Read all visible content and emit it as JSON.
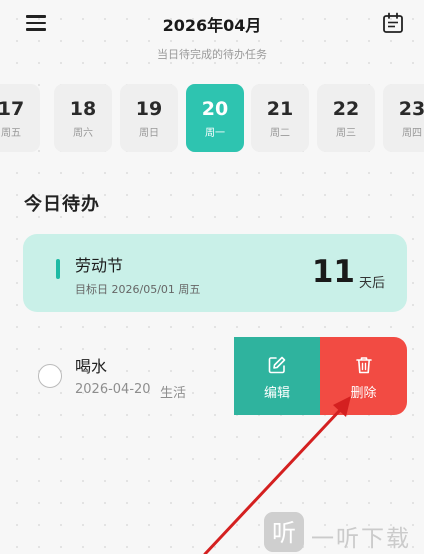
{
  "header": {
    "menu_icon": "hamburger-menu-icon",
    "title": "2026年04月",
    "subtitle": "当日待完成的待办任务",
    "calendar_icon": "calendar-icon"
  },
  "date_strip": [
    {
      "day": "17",
      "weekday": "周五",
      "active": false
    },
    {
      "day": "18",
      "weekday": "周六",
      "active": false
    },
    {
      "day": "19",
      "weekday": "周日",
      "active": false
    },
    {
      "day": "20",
      "weekday": "周一",
      "active": true
    },
    {
      "day": "21",
      "weekday": "周二",
      "active": false
    },
    {
      "day": "22",
      "weekday": "周三",
      "active": false
    },
    {
      "day": "23",
      "weekday": "周四",
      "active": false
    }
  ],
  "section": {
    "title": "今日待办"
  },
  "event_card": {
    "name": "劳动节",
    "target_text": "目标日 2026/05/01 周五",
    "days": "11",
    "unit": "天后"
  },
  "todo": {
    "title": "喝水",
    "date": "2026-04-20",
    "category": "生活",
    "checked": false
  },
  "swipe_actions": {
    "edit_label": "编辑",
    "delete_label": "删除",
    "edit_icon": "edit-icon",
    "delete_icon": "trash-icon"
  },
  "watermark": {
    "text": "一听下载",
    "badge_char": "听"
  },
  "colors": {
    "accent": "#2ec4b0",
    "event_bg": "#c9f0e8",
    "edit": "#2fb39e",
    "delete": "#f24b43",
    "arrow": "#d42020"
  }
}
